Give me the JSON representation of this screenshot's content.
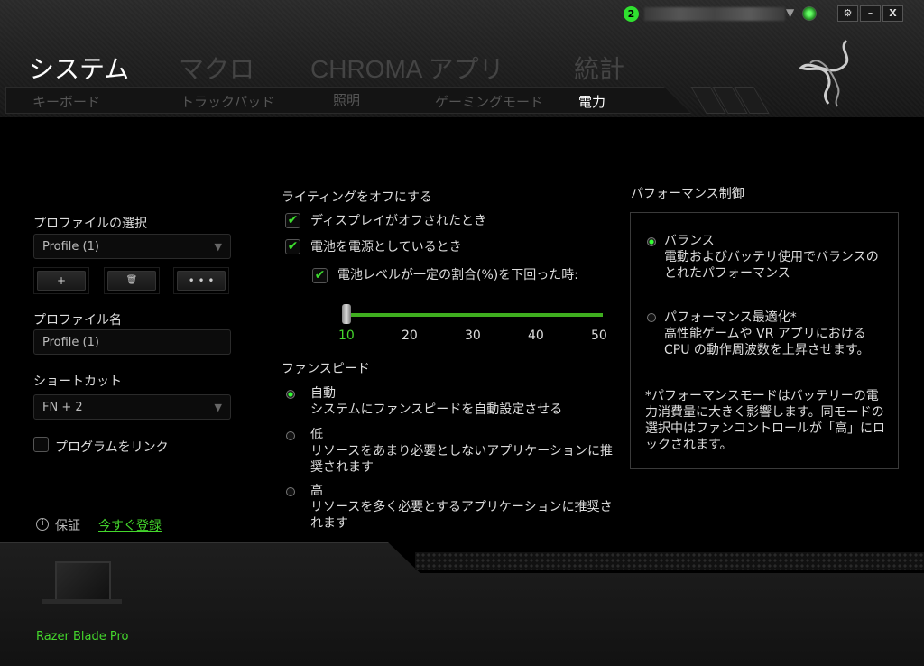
{
  "topbar": {
    "notification_count": "2",
    "settings": "⚙",
    "minimize": "–",
    "close": "X"
  },
  "main_tabs": [
    {
      "label": "システム"
    },
    {
      "label": "マクロ"
    },
    {
      "label": "CHROMA アプリ"
    },
    {
      "label": "統計"
    }
  ],
  "sub_tabs": [
    {
      "label": "キーボード"
    },
    {
      "label": "トラックパッド"
    },
    {
      "label": "照明"
    },
    {
      "label": "ゲーミングモード"
    },
    {
      "label": "電力"
    }
  ],
  "profile": {
    "select_label": "プロファイルの選択",
    "selected": "Profile (1)",
    "add": "+",
    "delete": "🗑",
    "more": "• • •",
    "name_label": "プロファイル名",
    "name_value": "Profile (1)",
    "shortcut_label": "ショートカット",
    "shortcut_value": "FN + 2",
    "link_program": "プログラムをリンク"
  },
  "warranty": {
    "label": "保証",
    "register": "今すぐ登録"
  },
  "lighting": {
    "title": "ライティングをオフにする",
    "opt_display": "ディスプレイがオフされたとき",
    "opt_battery": "電池を電源としているとき",
    "opt_level": "電池レベルが一定の割合(%)を下回った時:",
    "slider_value": 10,
    "slider_min": 10,
    "slider_max": 50,
    "ticks": [
      "10",
      "20",
      "30",
      "40",
      "50"
    ]
  },
  "fan": {
    "title": "ファンスピード",
    "options": [
      {
        "name": "自動",
        "desc": "システムにファンスピードを自動設定させる",
        "selected": true
      },
      {
        "name": "低",
        "desc": "リソースをあまり必要としないアプリケーションに推奨されます",
        "selected": false
      },
      {
        "name": "高",
        "desc": "リソースを多く必要とするアプリケーションに推奨されます",
        "selected": false
      }
    ]
  },
  "performance": {
    "title": "パフォーマンス制御",
    "options": [
      {
        "name": "バランス",
        "desc": "電動およびバッテリ使用でバランスのとれたパフォーマンス",
        "selected": true
      },
      {
        "name": "パフォーマンス最適化*",
        "desc": "高性能ゲームや VR アプリにおける CPU の動作周波数を上昇させます。",
        "selected": false
      }
    ],
    "note": "*パフォーマンスモードはバッテリーの電力消費量に大きく影響します。同モードの選択中はファンコントロールが「高」にロックされます。"
  },
  "device": {
    "name": "Razer Blade Pro"
  },
  "colors": {
    "accent": "#44d62c"
  }
}
